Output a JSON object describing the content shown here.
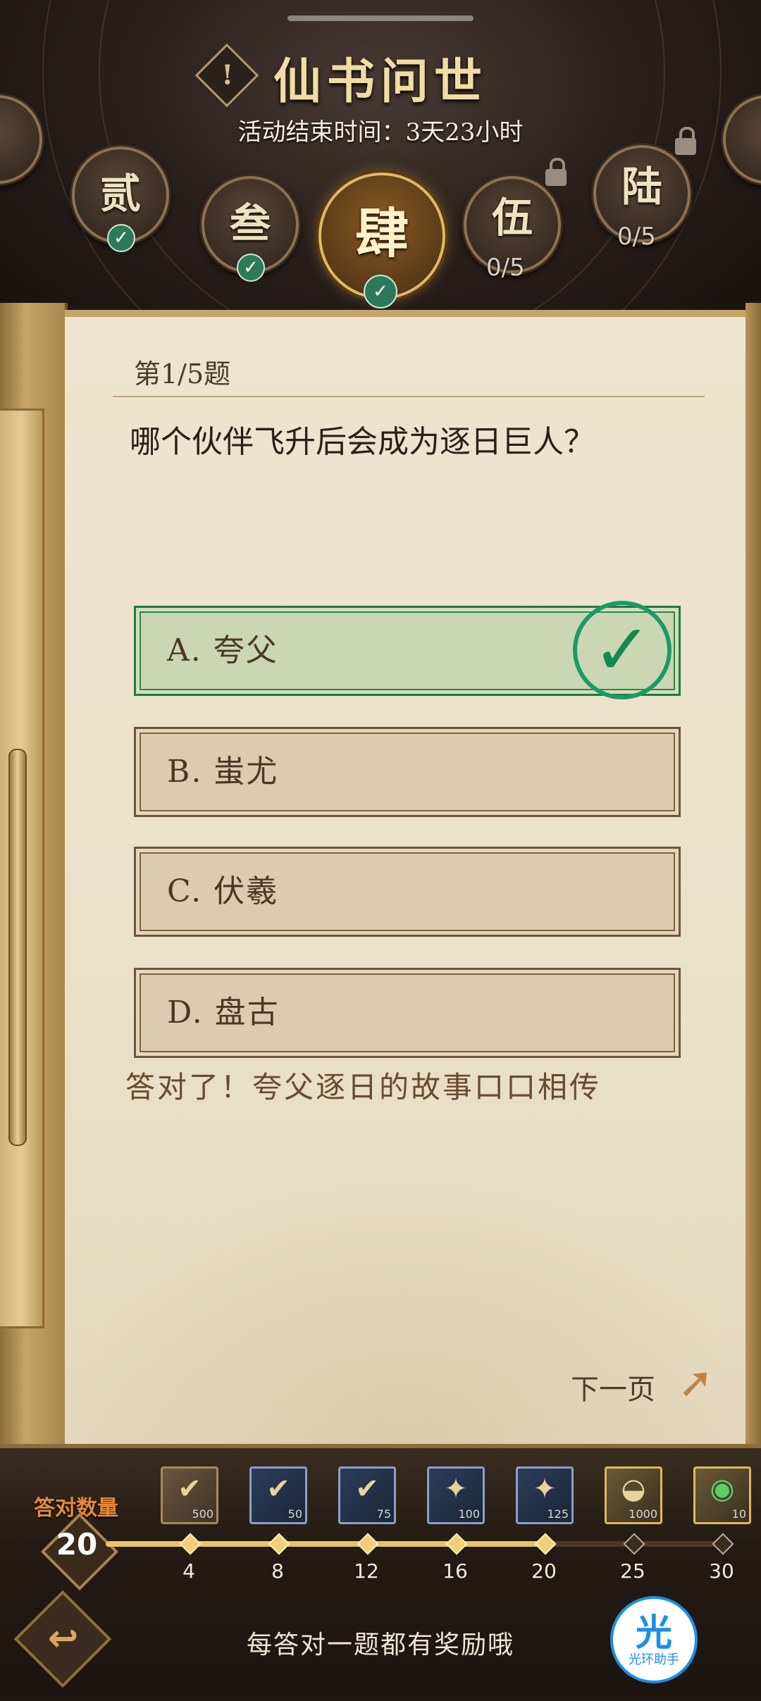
{
  "header": {
    "title": "仙书问世",
    "deadline": "活动结束时间：3天23小时",
    "chapters": [
      {
        "label": "贰",
        "state": "completed"
      },
      {
        "label": "叁",
        "state": "completed"
      },
      {
        "label": "肆",
        "state": "current"
      },
      {
        "label": "伍",
        "state": "locked",
        "progress": "0/5"
      },
      {
        "label": "陆",
        "state": "locked",
        "progress": "0/5"
      }
    ]
  },
  "quiz": {
    "number": "第1/5题",
    "question": "哪个伙伴飞升后会成为逐日巨人？",
    "options": [
      {
        "label": "A. 夸父",
        "correct": true
      },
      {
        "label": "B. 蚩尤"
      },
      {
        "label": "C. 伏羲"
      },
      {
        "label": "D. 盘古"
      }
    ],
    "feedback": "答对了！夸父逐日的故事口口相传",
    "next_label": "下一页"
  },
  "rewards": {
    "label": "答对数量",
    "count": "20",
    "milestones": [
      "4",
      "8",
      "12",
      "16",
      "20",
      "25",
      "30"
    ],
    "items": [
      {
        "qty": "500",
        "icon": "jade-token-icon"
      },
      {
        "qty": "50",
        "icon": "scroll-ticket-icon"
      },
      {
        "qty": "75",
        "icon": "scroll-ticket-icon"
      },
      {
        "qty": "100",
        "icon": "talisman-pack-icon"
      },
      {
        "qty": "125",
        "icon": "talisman-pack-icon"
      },
      {
        "qty": "1000",
        "icon": "gold-ingot-icon"
      },
      {
        "qty": "10",
        "icon": "dragon-orb-icon"
      }
    ]
  },
  "footer": {
    "hint": "每答对一题都有奖励哦",
    "assistant_big": "光",
    "assistant_small": "光环助手"
  },
  "colors": {
    "title_gold": "#f3dca4",
    "correct_green": "#1f7a3a",
    "progress_fill": "#e9c46a",
    "accent_orange": "#e08a3c"
  }
}
